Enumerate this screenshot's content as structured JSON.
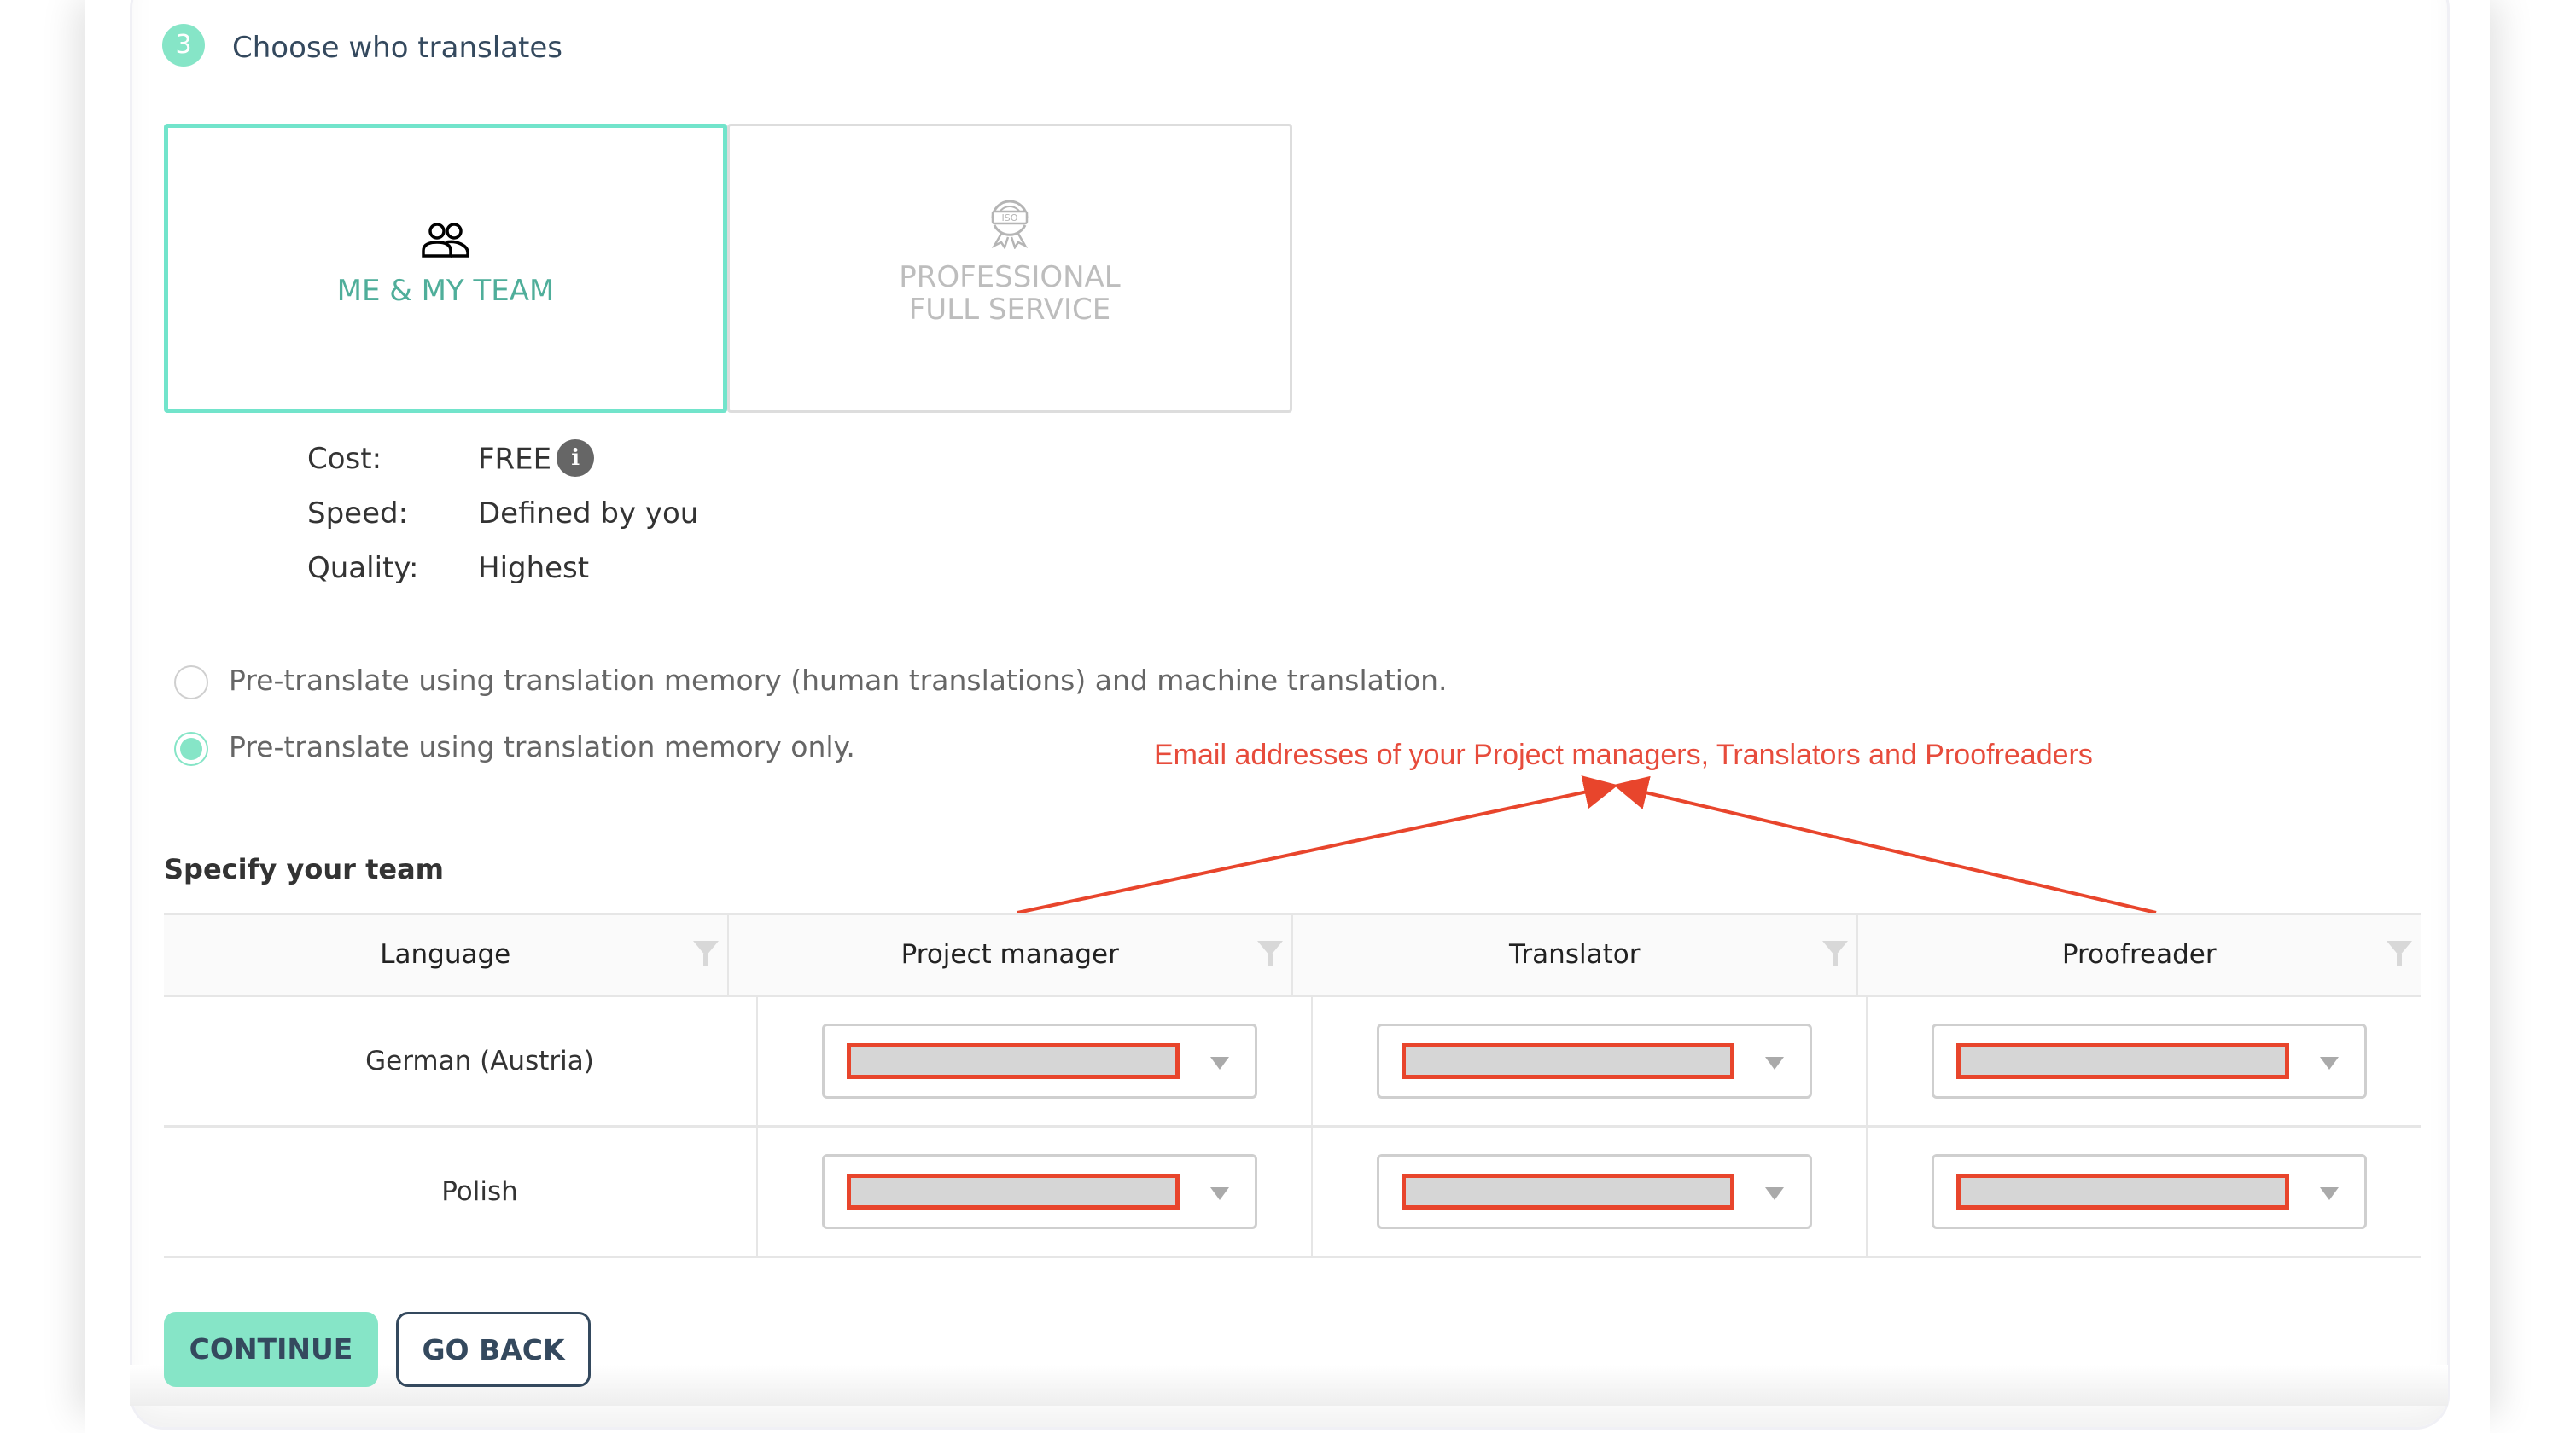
{
  "step": {
    "number": "3",
    "title": "Choose who translates"
  },
  "options": [
    {
      "label": "ME & MY TEAM",
      "icon": "team-icon",
      "selected": true
    },
    {
      "label_line1": "PROFESSIONAL",
      "label_line2": "FULL SERVICE",
      "icon": "iso-badge-icon",
      "selected": false
    }
  ],
  "details": {
    "cost_label": "Cost:",
    "cost_value": "FREE",
    "info_glyph": "i",
    "speed_label": "Speed:",
    "speed_value": "Defined by you",
    "quality_label": "Quality:",
    "quality_value": "Highest"
  },
  "pretranslate": [
    {
      "label": "Pre-translate using translation memory (human translations) and machine translation.",
      "checked": false
    },
    {
      "label": "Pre-translate using translation memory only.",
      "checked": true
    }
  ],
  "annotation": {
    "text": "Email addresses of your Project managers, Translators and Proofreaders",
    "color": "#e74c3c"
  },
  "team": {
    "title": "Specify your team",
    "columns": [
      "Language",
      "Project manager",
      "Translator",
      "Proofreader"
    ],
    "rows": [
      {
        "language": "German (Austria)",
        "project_manager": "[redacted]",
        "translator": "[redacted]",
        "proofreader": "[redacted]"
      },
      {
        "language": "Polish",
        "project_manager": "[redacted]",
        "translator": "[redacted]",
        "proofreader": "[redacted]"
      }
    ]
  },
  "buttons": {
    "continue": "CONTINUE",
    "go_back": "GO BACK"
  },
  "colors": {
    "accent": "#86e5c7",
    "accent_border": "#72e4cb",
    "accent_text": "#4fae9a",
    "dark": "#34495e",
    "redaction_border": "#e8452c"
  }
}
